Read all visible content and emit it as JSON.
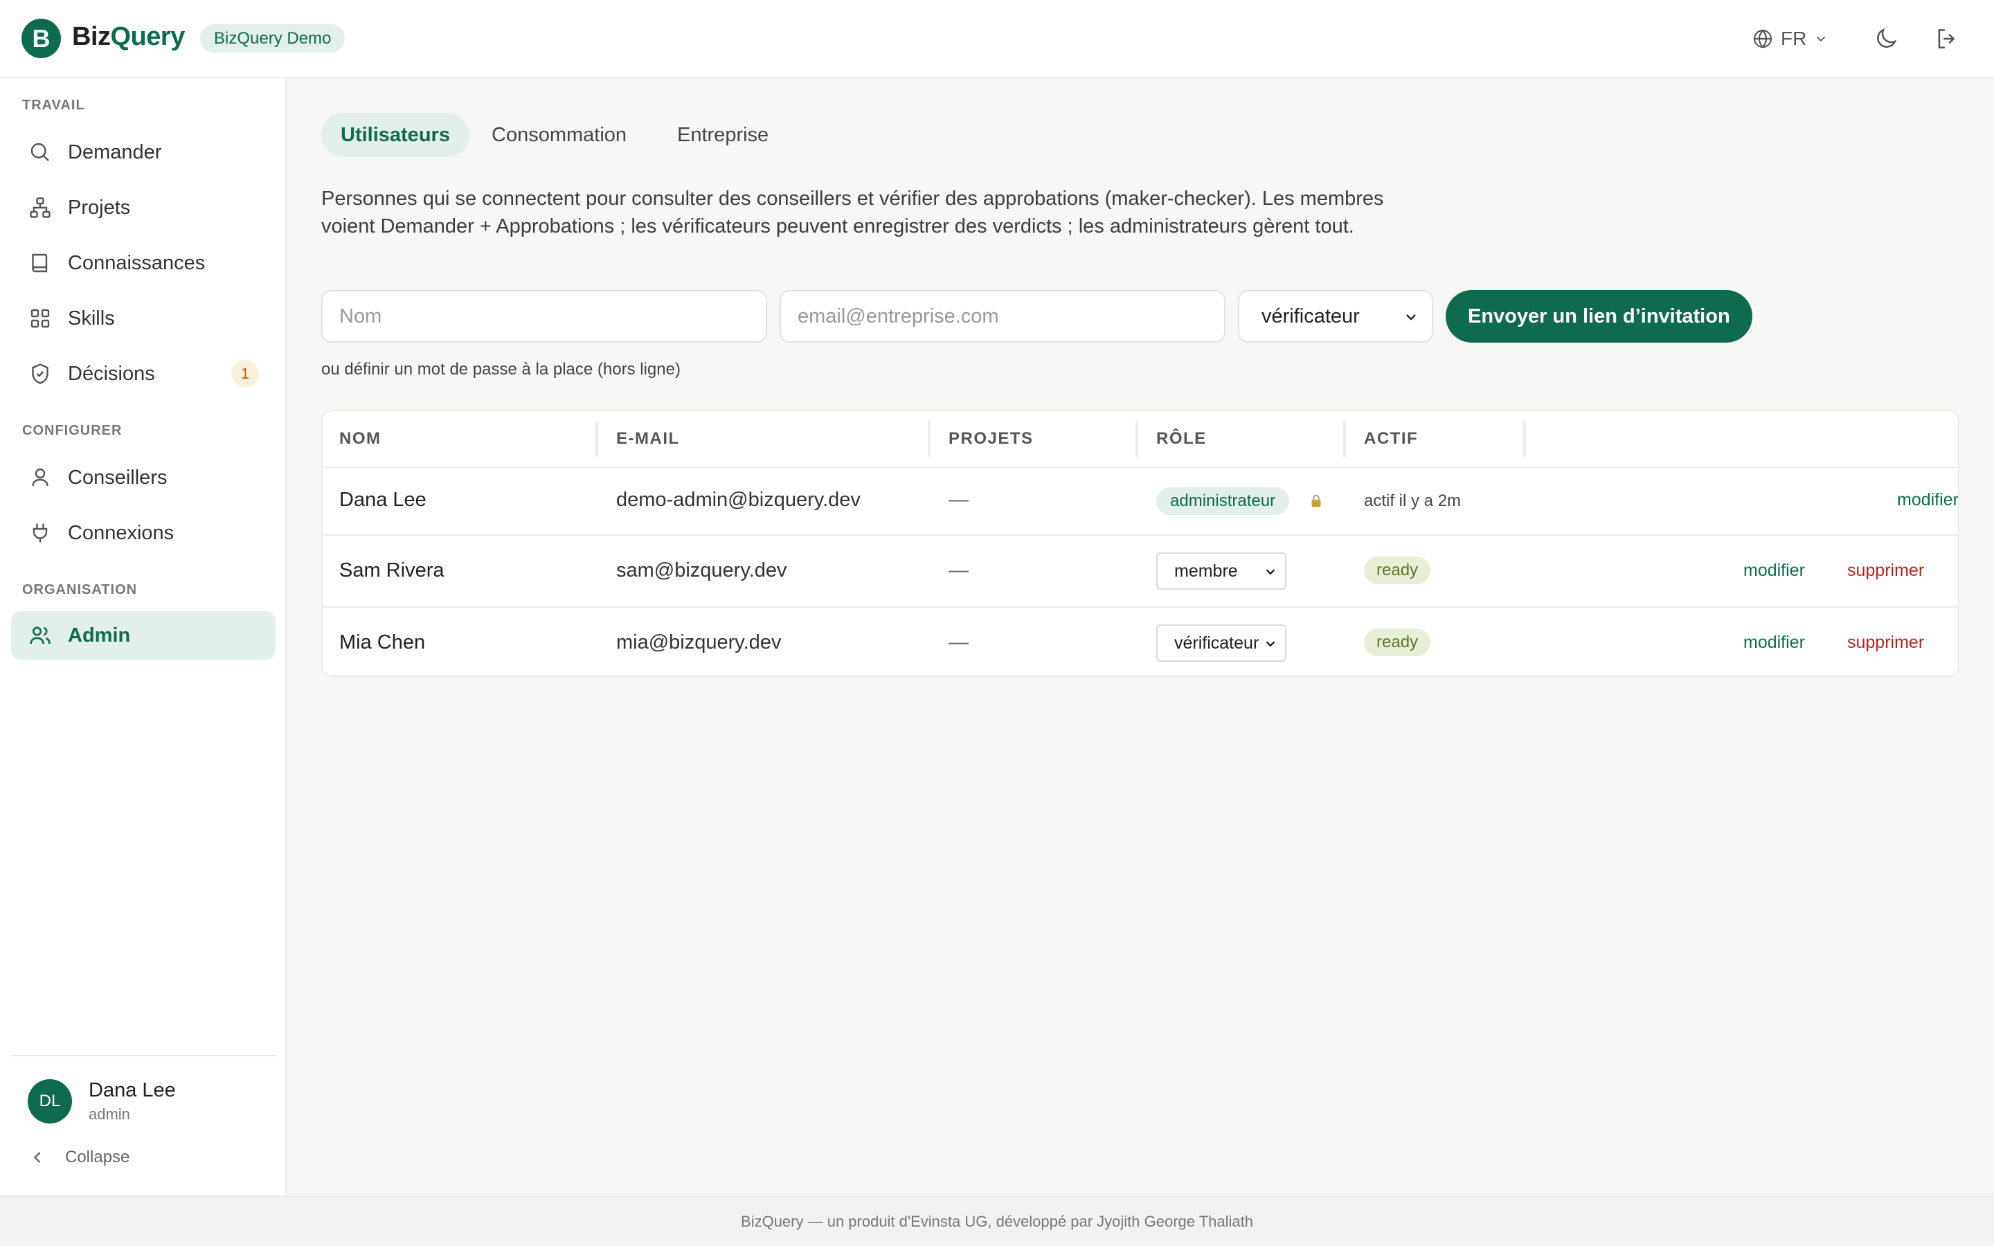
{
  "header": {
    "logo_letter": "B",
    "app_name_part1": "Biz",
    "app_name_part2": "Query",
    "demo_badge": "BizQuery Demo",
    "language": "FR",
    "brand_color": "#0e6b4f"
  },
  "sidebar": {
    "sections": [
      {
        "label": "TRAVAIL"
      },
      {
        "label": "CONFIGURER"
      },
      {
        "label": "ORGANISATION"
      }
    ],
    "items": [
      {
        "label": "Demander",
        "icon": "search-icon"
      },
      {
        "label": "Projets",
        "icon": "project-tree-icon"
      },
      {
        "label": "Connaissances",
        "icon": "book-icon"
      },
      {
        "label": "Skills",
        "icon": "grid-icon"
      },
      {
        "label": "Décisions",
        "icon": "shield-check-icon",
        "count": "1"
      },
      {
        "label": "Conseillers",
        "icon": "user-icon"
      },
      {
        "label": "Connexions",
        "icon": "plug-icon"
      },
      {
        "label": "Admin",
        "icon": "users-icon",
        "active": true
      }
    ],
    "user": {
      "initials": "DL",
      "name": "Dana Lee",
      "role": "admin"
    },
    "collapse_label": "Collapse"
  },
  "tabs": [
    {
      "label": "Utilisateurs",
      "active": true
    },
    {
      "label": "Consommation"
    },
    {
      "label": "Entreprise"
    }
  ],
  "description": "Personnes qui se connectent pour consulter des conseillers et vérifier des approbations (maker-checker). Les membres voient Demander + Approbations ; les vérificateurs peuvent enregistrer des verdicts ; les administrateurs gèrent tout.",
  "invite": {
    "name_placeholder": "Nom",
    "email_placeholder": "email@entreprise.com",
    "role_value": "vérificateur",
    "button_label": "Envoyer un lien d’invitation",
    "hint": "ou définir un mot de passe à la place (hors ligne)"
  },
  "table": {
    "headers": [
      "NOM",
      "E-MAIL",
      "PROJETS",
      "RÔLE",
      "ACTIF"
    ],
    "rows": [
      {
        "name": "Dana Lee",
        "email": "demo-admin@bizquery.dev",
        "projects": "—",
        "role": "administrateur",
        "role_locked": true,
        "active": "actif il y a 2m",
        "edit": "modifier"
      },
      {
        "name": "Sam Rivera",
        "email": "sam@bizquery.dev",
        "projects": "—",
        "role": "membre",
        "active": "ready",
        "edit": "modifier",
        "delete": "supprimer"
      },
      {
        "name": "Mia Chen",
        "email": "mia@bizquery.dev",
        "projects": "—",
        "role": "vérificateur",
        "active": "ready",
        "edit": "modifier",
        "delete": "supprimer"
      }
    ]
  },
  "footer": "BizQuery — un produit d'Evinsta UG, développé par Jyojith George Thaliath"
}
